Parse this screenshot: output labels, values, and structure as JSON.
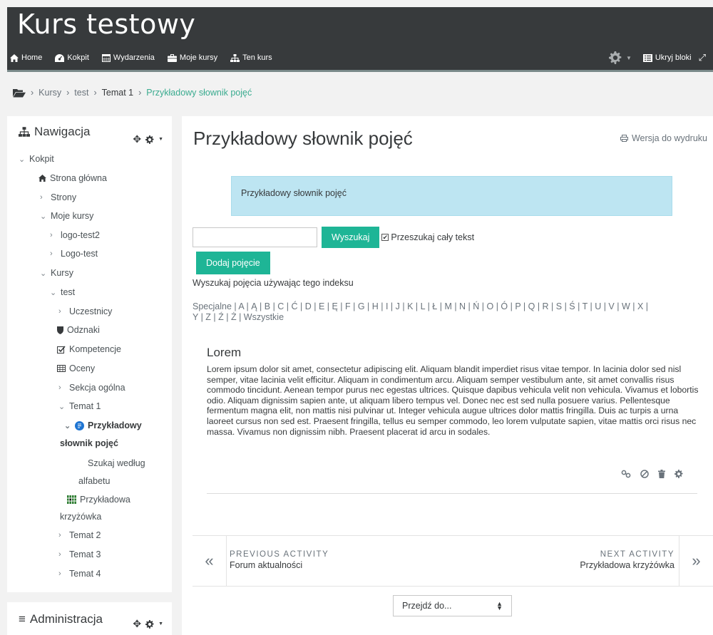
{
  "site": {
    "title": "Kurs testowy"
  },
  "topnav": {
    "items": [
      {
        "label": "Home",
        "icon": "home-icon"
      },
      {
        "label": "Kokpit",
        "icon": "dashboard-icon"
      },
      {
        "label": "Wydarzenia",
        "icon": "calendar-icon"
      },
      {
        "label": "Moje kursy",
        "icon": "briefcase-icon"
      },
      {
        "label": "Ten kurs",
        "icon": "sitemap-icon"
      }
    ],
    "hide_blocks_label": "Ukryj bloki"
  },
  "breadcrumb": {
    "items": [
      "Kursy",
      "test",
      "Temat 1",
      "Przykładowy słownik pojęć"
    ]
  },
  "navigation": {
    "title": "Nawigacja",
    "tree": [
      {
        "label": "Kokpit"
      },
      {
        "label": "Strona główna"
      },
      {
        "label": "Strony"
      },
      {
        "label": "Moje kursy"
      },
      {
        "label": "logo-test2"
      },
      {
        "label": "Logo-test"
      },
      {
        "label": "Kursy"
      },
      {
        "label": "test"
      },
      {
        "label": "Uczestnicy"
      },
      {
        "label": "Odznaki"
      },
      {
        "label": "Kompetencje"
      },
      {
        "label": "Oceny"
      },
      {
        "label": "Sekcja ogólna"
      },
      {
        "label": "Temat 1"
      },
      {
        "label": "Przykładowy"
      },
      {
        "label": "słownik pojęć"
      },
      {
        "label": "Szukaj według"
      },
      {
        "label": "alfabetu"
      },
      {
        "label": "Przykładowa"
      },
      {
        "label": "krzyżówka"
      },
      {
        "label": "Temat 2"
      },
      {
        "label": "Temat 3"
      },
      {
        "label": "Temat 4"
      }
    ]
  },
  "admin": {
    "title": "Administracja"
  },
  "main": {
    "title": "Przykładowy słownik pojęć",
    "print_label": "Wersja do wydruku",
    "intro": "Przykładowy słownik pojęć",
    "search": {
      "value": "",
      "button": "Wyszukaj",
      "fulltext_label": "Przeszukaj cały tekst",
      "fulltext_checked": true
    },
    "add_button": "Dodaj pojęcie",
    "index_label": "Wyszukaj pojęcia używając tego indeksu",
    "alphabet_line1": "Specjalne | A | Ą | B | C | Ć | D | E | Ę | F | G | H | I | J | K | L | Ł | M | N | Ń | O | Ó | P | Q | R | S | Ś | T | U | V | W | X |",
    "alphabet_line2": "Y | Z | Ź | Ż | Wszystkie",
    "entry": {
      "title": "Lorem",
      "text": "Lorem ipsum dolor sit amet, consectetur adipiscing elit. Aliquam blandit imperdiet risus vitae tempor. In lacinia dolor sed nisl semper, vitae lacinia velit efficitur. Aliquam in condimentum arcu. Aliquam semper vestibulum ante, sit amet convallis risus commodo tincidunt. Aenean tempor purus nec egestas ultrices. Quisque dapibus vehicula velit non vehicula. Vivamus et lobortis odio. Aliquam dignissim sapien ante, ut aliquam libero tempus vel. Donec nec est sed nulla posuere varius. Pellentesque fermentum magna elit, non mattis nisi pulvinar ut. Integer vehicula augue ultrices dolor mattis fringilla. Duis ac turpis a urna laoreet cursus non sed est. Praesent fringilla, tellus eu semper commodo, leo lorem vulputate sapien, vitae mattis orci risus nec massa. Vivamus non dignissim nibh. Praesent placerat id arcu in sodales."
    },
    "prev_activity": {
      "label": "PREVIOUS ACTIVITY",
      "name": "Forum aktualności"
    },
    "next_activity": {
      "label": "NEXT ACTIVITY",
      "name": "Przykładowa krzyżówka"
    },
    "jump_select": "Przejdź do..."
  },
  "colors": {
    "header": "#373a3c",
    "accent": "#1eb596",
    "intro_bg": "#bde5f2",
    "link_active": "#3aab8f"
  }
}
